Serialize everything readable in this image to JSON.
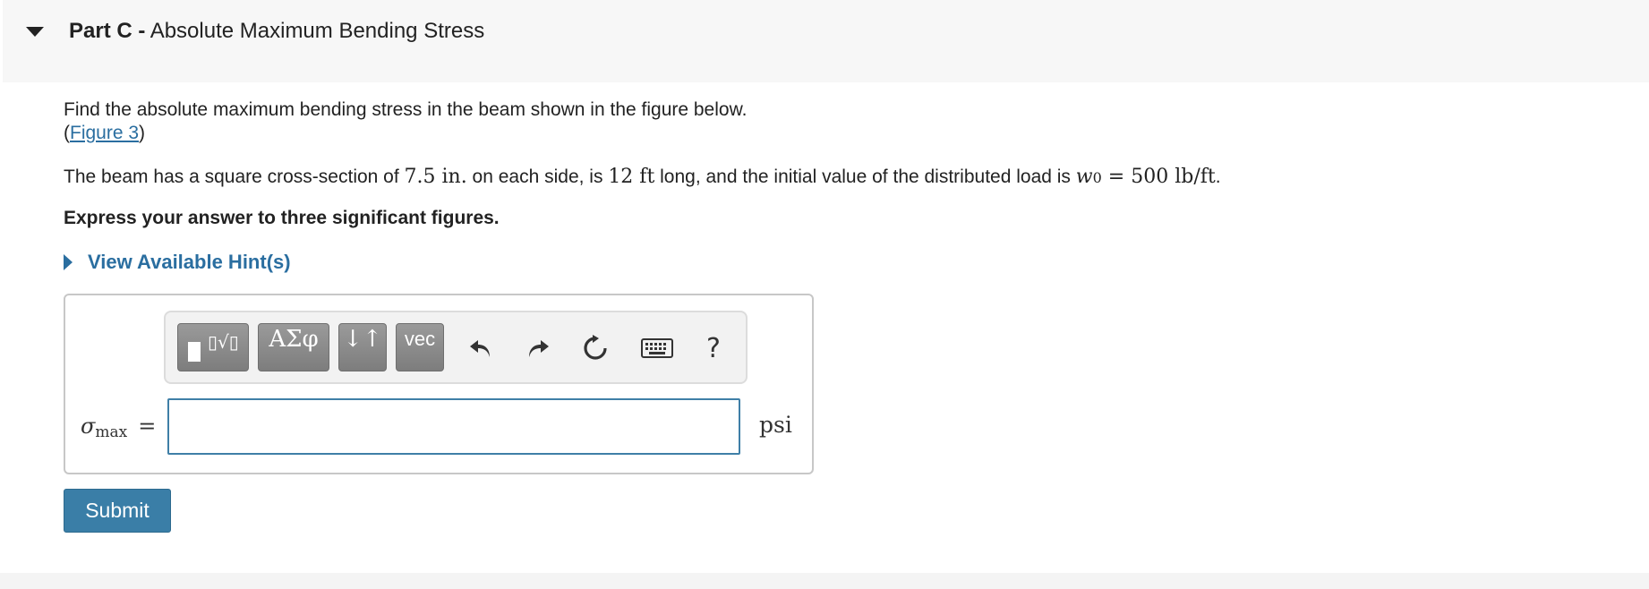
{
  "part": {
    "label": "Part C -",
    "title": "Absolute Maximum Bending Stress"
  },
  "prompt": {
    "line1": "Find the absolute maximum bending stress in the beam shown in the figure below.",
    "paren_open": "(",
    "figure_link": "Figure 3",
    "paren_close": ")"
  },
  "beam": {
    "t1": "The beam has a square cross-section of ",
    "side": "7.5 in.",
    "t2": " on each side, is ",
    "length": "12 ft",
    "t3": " long, and the initial value of the distributed load is ",
    "w_symbol": "w",
    "w_subscript": "0",
    "eq": " = ",
    "load": "500 lb/ft",
    "t4": "."
  },
  "sigfigs": "Express your answer to three significant figures.",
  "hint": {
    "label": "View Available Hint(s)"
  },
  "toolbar": {
    "templates_label": "▯√▯",
    "greek_label": "ΑΣφ",
    "arrows_label": "↓↑",
    "vec_label": "vec",
    "help_label": "?",
    "icons": [
      "templates-icon",
      "greek-icon",
      "arrows-icon",
      "vec-icon",
      "undo-icon",
      "redo-icon",
      "reset-icon",
      "keyboard-icon",
      "help-icon"
    ]
  },
  "answer": {
    "symbol": "σ",
    "subscript": "max",
    "equals": "=",
    "value": "",
    "unit": "psi"
  },
  "submit_label": "Submit",
  "colors": {
    "link": "#2a6ea0",
    "button": "#3a7ea7",
    "input_border": "#3f7fa7"
  }
}
